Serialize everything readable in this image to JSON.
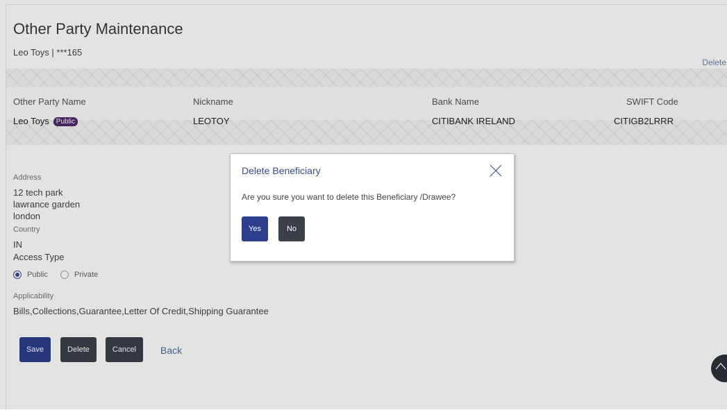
{
  "page": {
    "title": "Other Party Maintenance",
    "subtitle": "Leo Toys | ***165",
    "delete_link": "Delete"
  },
  "summary": {
    "headers": {
      "name": "Other Party Name",
      "nickname": "Nickname",
      "bank": "Bank Name",
      "swift": "SWIFT Code"
    },
    "values": {
      "name": "Leo Toys",
      "badge": "Public",
      "nickname": "LEOTOY",
      "bank": "CITIBANK IRELAND",
      "swift": "CITIGB2LRRR"
    }
  },
  "details": {
    "address_label": "Address",
    "address_lines": [
      "12 tech park",
      "lawrance garden",
      "london"
    ],
    "country_label": "Country",
    "country_value": "IN",
    "access_type_label": "Access Type",
    "access_options": [
      {
        "label": "Public",
        "selected": true
      },
      {
        "label": "Private",
        "selected": false
      }
    ],
    "applicability_label": "Applicability",
    "applicability_value": "Bills,Collections,Guarantee,Letter Of Credit,Shipping Guarantee"
  },
  "actions": {
    "save": "Save",
    "delete": "Delete",
    "cancel": "Cancel",
    "back": "Back"
  },
  "modal": {
    "title": "Delete Beneficiary",
    "message": "Are you sure you want to delete this Beneficiary /Drawee?",
    "yes": "Yes",
    "no": "No",
    "close_icon": "close-icon"
  },
  "icons": {
    "scroll_top": "chevron-up-icon"
  },
  "colors": {
    "primary_button": "#2c3e8c",
    "dark_button": "#3b3f48",
    "badge": "#4e2a6e",
    "link": "#4d6b8f",
    "modal_title": "#3a4a8a"
  }
}
